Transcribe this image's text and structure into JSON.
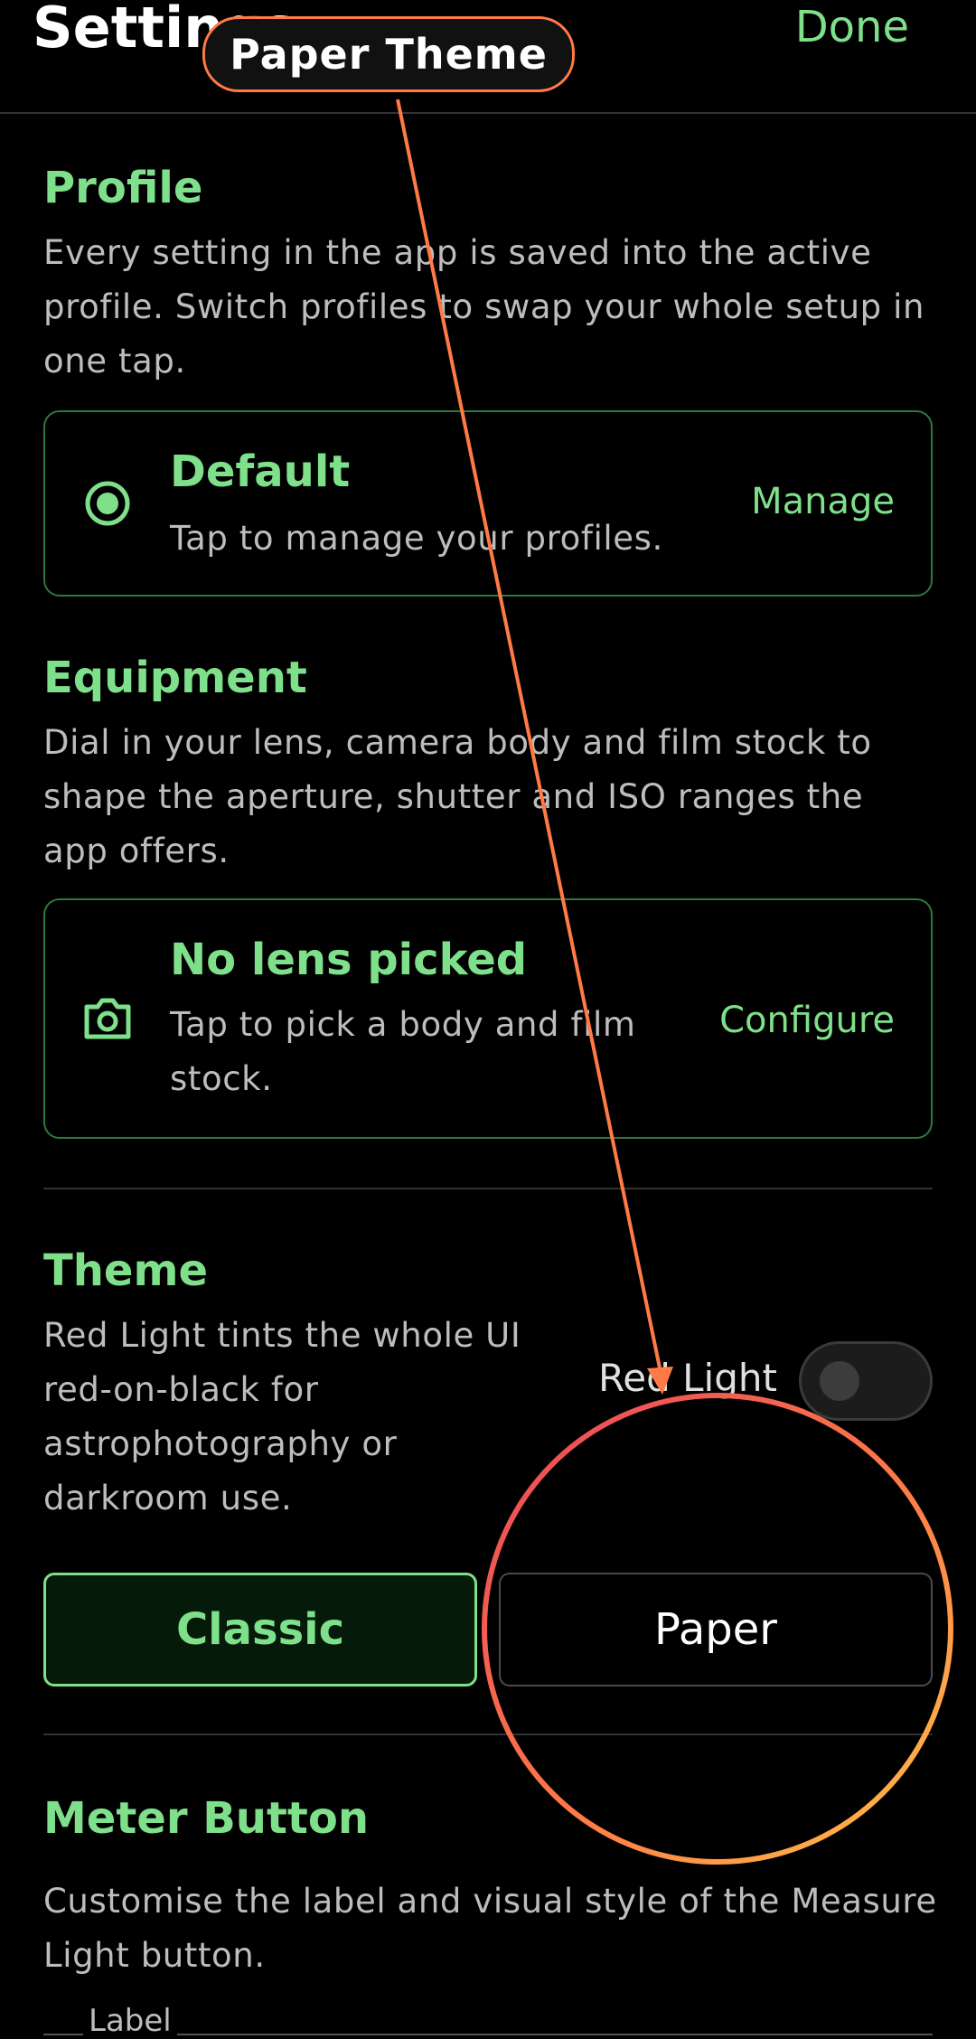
{
  "header": {
    "title": "Settings",
    "done_label": "Done"
  },
  "profile": {
    "heading": "Profile",
    "description": "Every setting in the app is saved into the active profile. Switch profiles to swap your whole setup in one tap.",
    "card": {
      "title": "Default",
      "subtitle": "Tap to manage your profiles.",
      "action": "Manage",
      "icon": "radio-selected-icon"
    }
  },
  "equipment": {
    "heading": "Equipment",
    "description": "Dial in your lens, camera body and film stock to shape the aperture, shutter and ISO ranges the app offers.",
    "card": {
      "title": "No lens picked",
      "subtitle": "Tap to pick a body and film stock.",
      "action": "Configure",
      "icon": "camera-icon"
    }
  },
  "theme": {
    "heading": "Theme",
    "description": "Red Light tints the whole UI red-on-black for astrophotography or darkroom use.",
    "red_light_label": "Red Light",
    "red_light_on": false,
    "options": [
      "Classic",
      "Paper"
    ],
    "selected": "Classic"
  },
  "meter_button": {
    "heading": "Meter Button",
    "description": "Customise the label and visual style of the Measure Light button.",
    "label_field": "Label"
  },
  "overlay": {
    "tooltip": "Paper Theme",
    "colors": {
      "accent": "#7ee08a",
      "arrow": "#ff7a45",
      "ring_start": "#e8455a",
      "ring_end": "#ffc24a"
    }
  }
}
